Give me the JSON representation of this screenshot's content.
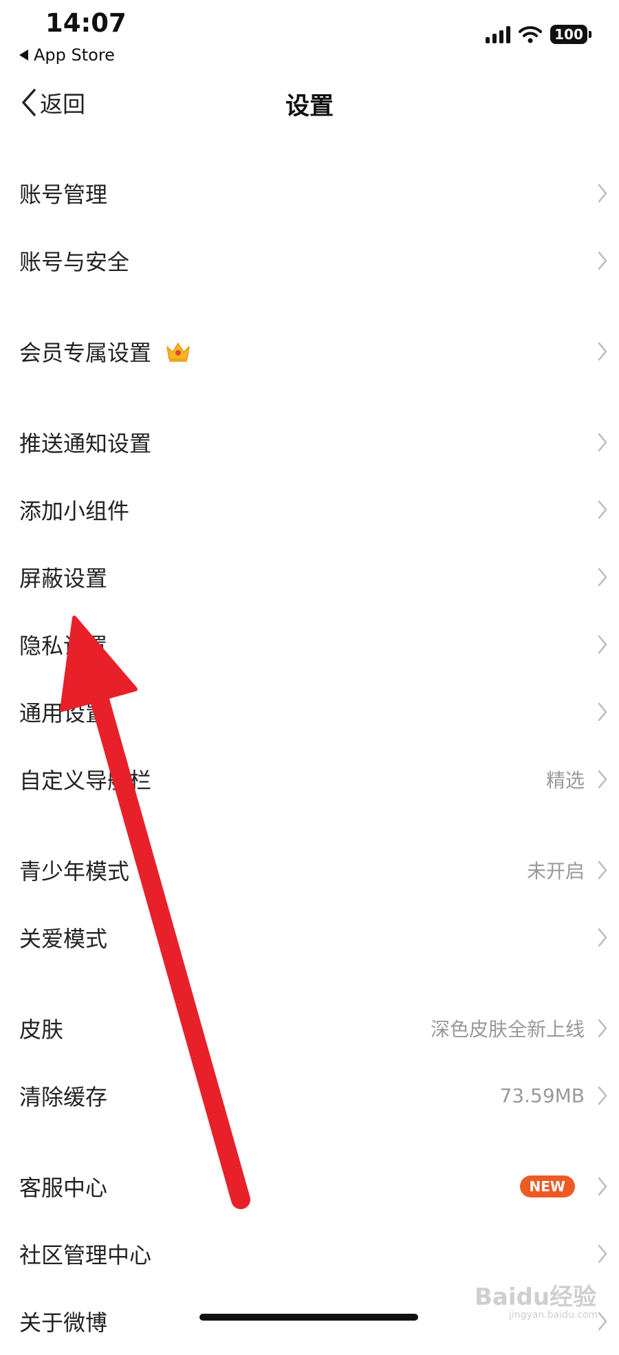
{
  "status_bar": {
    "time": "14:07",
    "back_app": "App Store",
    "battery": "100"
  },
  "nav": {
    "back_label": "返回",
    "title": "设置"
  },
  "menu": {
    "account_management": {
      "label": "账号管理"
    },
    "account_security": {
      "label": "账号与安全"
    },
    "member_settings": {
      "label": "会员专属设置",
      "icon": "crown-icon"
    },
    "push_notifications": {
      "label": "推送通知设置"
    },
    "add_widget": {
      "label": "添加小组件"
    },
    "block_settings": {
      "label": "屏蔽设置"
    },
    "privacy_settings": {
      "label": "隐私设置"
    },
    "general_settings": {
      "label": "通用设置"
    },
    "custom_navbar": {
      "label": "自定义导航栏",
      "value": "精选"
    },
    "teen_mode": {
      "label": "青少年模式",
      "value": "未开启"
    },
    "care_mode": {
      "label": "关爱模式"
    },
    "skin": {
      "label": "皮肤",
      "value": "深色皮肤全新上线"
    },
    "clear_cache": {
      "label": "清除缓存",
      "value": "73.59MB"
    },
    "customer_service": {
      "label": "客服中心",
      "badge": "NEW"
    },
    "community_center": {
      "label": "社区管理中心"
    },
    "about_weibo": {
      "label": "关于微博"
    }
  },
  "watermark": {
    "text": "Baidu经验",
    "url": "jingyan.baidu.com"
  },
  "colors": {
    "badge": "#ee5a24",
    "arrow": "#e8202a",
    "value_text": "#999999",
    "chevron": "#bbbbbb"
  }
}
